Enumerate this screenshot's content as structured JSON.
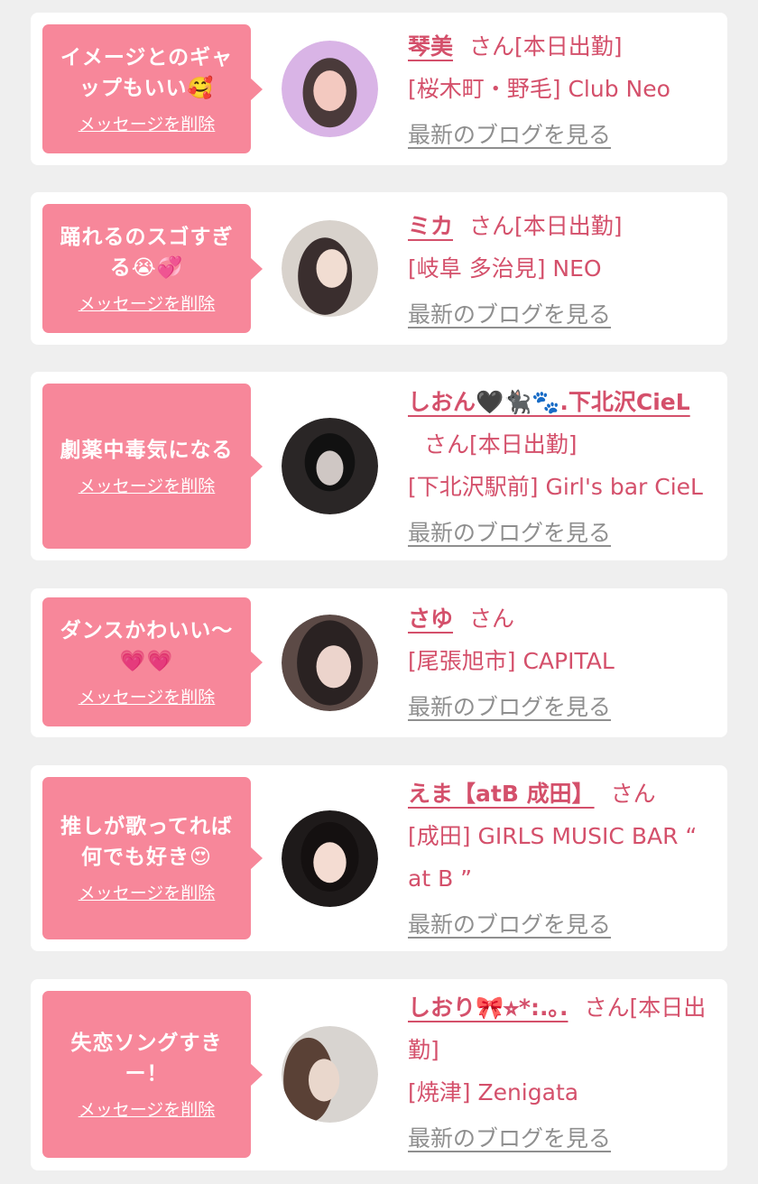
{
  "items": [
    {
      "message": "イメージとのギャップもいい🥰",
      "delete_label": "メッセージを削除",
      "name": "琴美",
      "suffix": "さん",
      "status": "[本日出勤]",
      "shop": "[桜木町・野毛] Club Neo",
      "blog_label": "最新のブログを見る",
      "avatar_colors": [
        "#d9b4e6",
        "#f3c9c0",
        "#4a3a3a"
      ]
    },
    {
      "message": "踊れるのスゴすぎる😭💞",
      "delete_label": "メッセージを削除",
      "name": "ミカ",
      "suffix": "さん",
      "status": "[本日出勤]",
      "shop": "[岐阜 多治見] NEO",
      "blog_label": "最新のブログを見る",
      "avatar_colors": [
        "#d8d2cc",
        "#f1ddd2",
        "#3a2e2e"
      ]
    },
    {
      "message": "劇薬中毒気になる",
      "delete_label": "メッセージを削除",
      "name": "しおん🖤🐈‍⬛🐾.下北沢CieL",
      "suffix": "さん",
      "status": "[本日出勤]",
      "shop": "[下北沢駅前] Girl's bar CieL",
      "blog_label": "最新のブログを見る",
      "avatar_colors": [
        "#2a2626",
        "#cfc7c4",
        "#111111"
      ]
    },
    {
      "message": "ダンスかわいい〜💗💗",
      "delete_label": "メッセージを削除",
      "name": "さゆ",
      "suffix": "さん",
      "status": "",
      "shop": "[尾張旭市] CAPITAL",
      "blog_label": "最新のブログを見る",
      "avatar_colors": [
        "#5c4a46",
        "#ecd4cc",
        "#2a2222"
      ]
    },
    {
      "message": "推しが歌ってれば何でも好き😍",
      "delete_label": "メッセージを削除",
      "name": "えま【atB 成田】",
      "suffix": "さん",
      "status": "",
      "shop": "[成田] GIRLS MUSIC BAR “ at B ”",
      "blog_label": "最新のブログを見る",
      "avatar_colors": [
        "#1e1a1a",
        "#f4dcd2",
        "#141010"
      ]
    },
    {
      "message": "失恋ソングすきー！",
      "delete_label": "メッセージを削除",
      "name": "しおり🎀⭐︎*:.｡.",
      "suffix": "さん",
      "status": "[本日出勤]",
      "shop": "[焼津] Zenigata",
      "blog_label": "最新のブログを見る",
      "avatar_colors": [
        "#d8d4d0",
        "#e9d7cc",
        "#5a4136"
      ]
    }
  ]
}
